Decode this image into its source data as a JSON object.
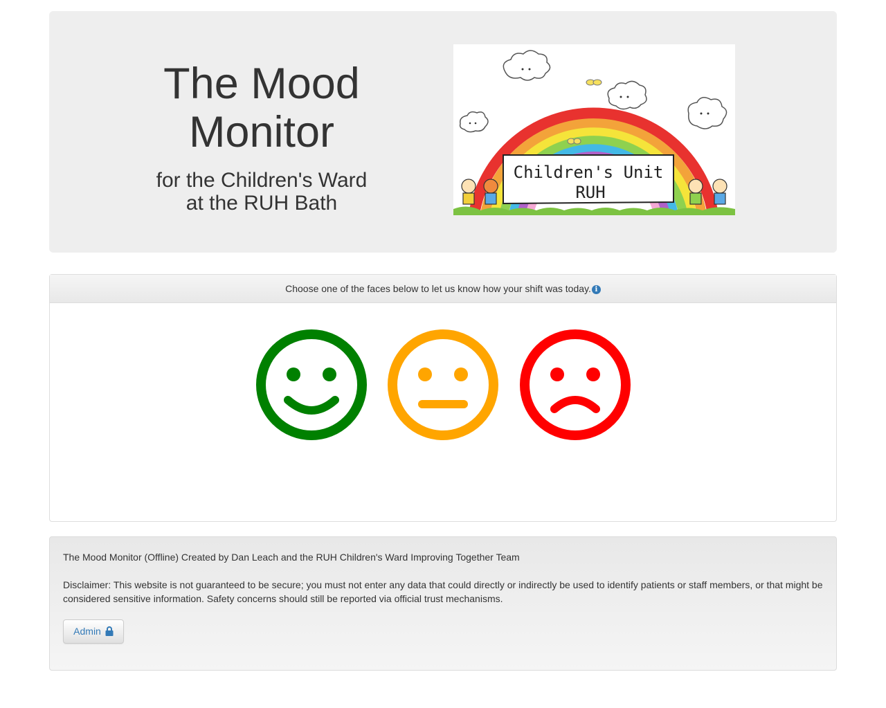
{
  "header": {
    "title": "The Mood Monitor",
    "subtitle_line1": "for the Children's Ward",
    "subtitle_line2": "at the RUH Bath",
    "logo": {
      "banner_line1": "Children's Unit",
      "banner_line2": "RUH"
    }
  },
  "panel": {
    "heading": "Choose one of the faces below to let us know how your shift was today.",
    "faces": [
      {
        "name": "happy-face",
        "color": "#008000"
      },
      {
        "name": "neutral-face",
        "color": "#ffa500"
      },
      {
        "name": "sad-face",
        "color": "#ff0000"
      }
    ]
  },
  "footer": {
    "credit": "The Mood Monitor (Offline) Created by Dan Leach and the RUH Children's Ward Improving Together Team",
    "disclaimer": "Disclaimer: This website is not guaranteed to be secure; you must not enter any data that could directly or indirectly be used to identify patients or staff members, or that might be considered sensitive information. Safety concerns should still be reported via official trust mechanisms.",
    "admin_label": "Admin"
  },
  "colors": {
    "link": "#337ab7",
    "jumbotron_bg": "#eeeeee"
  }
}
